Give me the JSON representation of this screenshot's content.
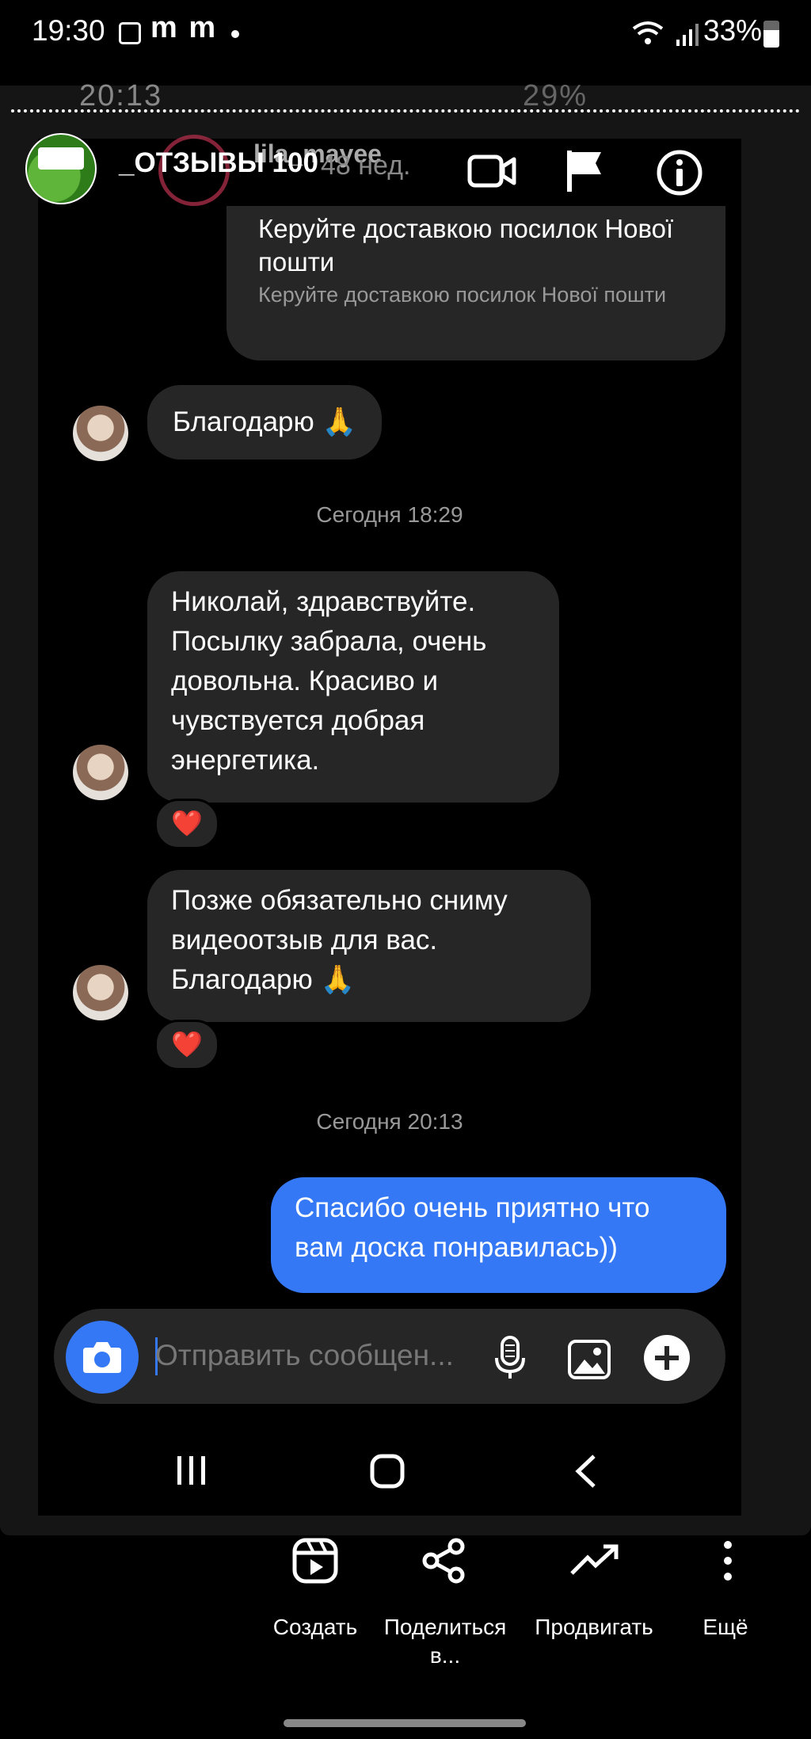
{
  "status_bar": {
    "time": "19:30",
    "carrier_marks": "m m",
    "battery": "33%"
  },
  "background_status": {
    "time": "20:13",
    "battery": "29%"
  },
  "story_header": {
    "title": "_ОТЗЫВЫ 100",
    "peer_name": "lila_mayee",
    "peer_time": "48 нед."
  },
  "chat": {
    "forwarded_card": {
      "title": "Керуйте доставкою посилок Нової пошти",
      "subtitle": "Керуйте доставкою посилок Нової пошти"
    },
    "messages": [
      {
        "direction": "in",
        "text": "Благодарю 🙏"
      },
      {
        "direction": "in",
        "text": "Николай, здравствуйте. Посылку забрала, очень довольна. Красиво и чувствуется добрая энергетика.",
        "reaction": "❤️"
      },
      {
        "direction": "in",
        "text": "Позже обязательно сниму видеоотзыв для вас. Благодарю 🙏",
        "reaction": "❤️"
      },
      {
        "direction": "out",
        "text": "Спасибо очень приятно что вам доска понравилась))"
      }
    ],
    "timestamps": [
      "Сегодня 18:29",
      "Сегодня 20:13"
    ]
  },
  "composer": {
    "placeholder": "Отправить сообщен..."
  },
  "actions": [
    {
      "label": "Создать",
      "icon": "reels-icon"
    },
    {
      "label": "Поделиться в...",
      "icon": "share-icon"
    },
    {
      "label": "Продвигать",
      "icon": "trending-icon"
    },
    {
      "label": "Ещё",
      "icon": "more-vertical-icon"
    }
  ],
  "colors": {
    "accent_blue": "#3478f6",
    "bubble_gray": "#262626",
    "background": "#000000",
    "heart_red": "#e02440"
  }
}
